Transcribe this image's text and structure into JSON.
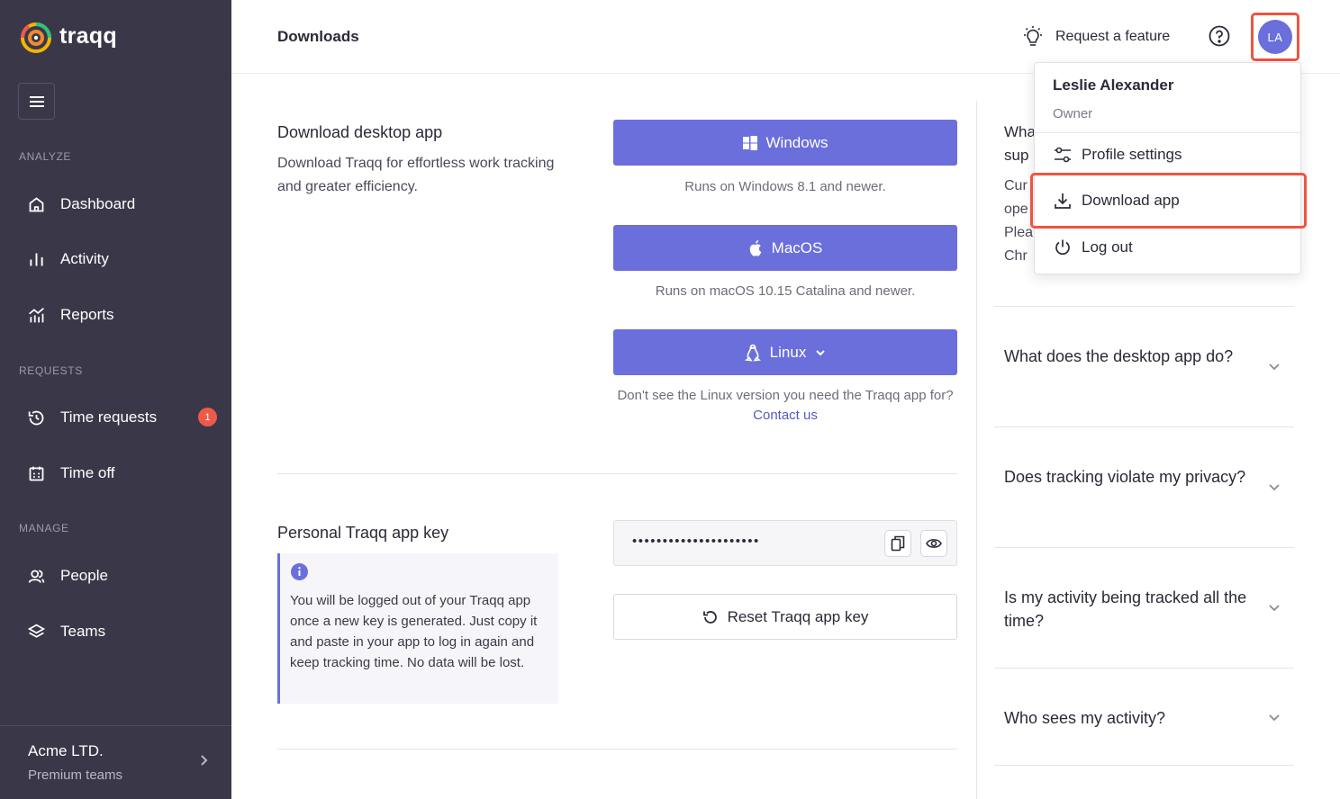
{
  "app": {
    "name": "traqq"
  },
  "sidebar": {
    "sections": {
      "analyze": "ANALYZE",
      "requests": "REQUESTS",
      "manage": "MANAGE"
    },
    "items": [
      {
        "label": "Dashboard",
        "icon": "home-icon"
      },
      {
        "label": "Activity",
        "icon": "bar-chart-icon"
      },
      {
        "label": "Reports",
        "icon": "reports-icon"
      },
      {
        "label": "Time requests",
        "icon": "history-icon",
        "badge": "1"
      },
      {
        "label": "Time off",
        "icon": "calendar-icon"
      },
      {
        "label": "People",
        "icon": "people-icon"
      },
      {
        "label": "Teams",
        "icon": "layers-icon"
      }
    ],
    "org": {
      "name": "Acme LTD.",
      "plan": "Premium teams"
    }
  },
  "header": {
    "title": "Downloads",
    "request_feature": "Request a feature",
    "avatar_initials": "LA"
  },
  "download": {
    "title": "Download desktop app",
    "description": "Download Traqq for effortless work tracking and greater efficiency.",
    "windows": {
      "label": "Windows",
      "note": "Runs on Windows 8.1 and newer."
    },
    "macos": {
      "label": "MacOS",
      "note": "Runs on macOS 10.15 Catalina and newer."
    },
    "linux": {
      "label": "Linux",
      "note": "Don't see the Linux version you need the Traqq app for?",
      "contact": "Contact us"
    }
  },
  "appkey": {
    "title": "Personal Traqq app key",
    "info": "You will be logged out of your Traqq app once a new key is generated. Just copy it and paste in your app to log in again and keep tracking time. No data will be lost.",
    "masked": "•••••••••••••••••••••",
    "reset_label": "Reset Traqq app key"
  },
  "faq_partial": [
    "Wha",
    "sup",
    "Cur",
    "ope",
    "Plea",
    "Chr"
  ],
  "faq": [
    "What does the desktop app do?",
    "Does tracking violate my privacy?",
    "Is my activity being tracked all the time?",
    "Who sees my activity?"
  ],
  "dropdown": {
    "name": "Leslie Alexander",
    "role": "Owner",
    "items": [
      "Profile settings",
      "Download app",
      "Log out"
    ]
  },
  "colors": {
    "sidebar": "#3a3848",
    "accent": "#6b6fdc",
    "highlight": "#f0543f",
    "badge": "#ee5a4a"
  }
}
